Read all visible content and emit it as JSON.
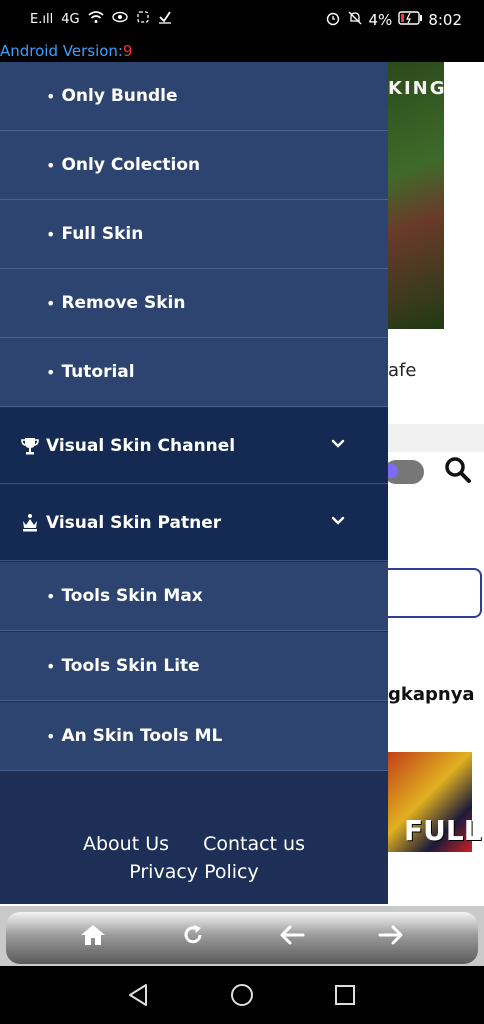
{
  "status_bar": {
    "network_left": "E.ıll",
    "network_4g": "4G",
    "battery_percent": "4%",
    "time": "8:02"
  },
  "version": {
    "label": "Android Version:",
    "value": "9"
  },
  "background_page": {
    "banner_text": "KING",
    "text_1": "afe",
    "text_2": "gkapnya",
    "thumb_text": "FULL"
  },
  "drawer": {
    "submenu_1": [
      {
        "label": "Only Bundle"
      },
      {
        "label": "Only Colection"
      },
      {
        "label": "Full Skin"
      },
      {
        "label": "Remove Skin"
      },
      {
        "label": "Tutorial"
      }
    ],
    "section_channel": {
      "label": "Visual Skin Channel",
      "icon": "trophy-icon"
    },
    "section_partner": {
      "label": "Visual Skin Patner",
      "icon": "crown-icon"
    },
    "submenu_2": [
      {
        "label": "Tools Skin Max"
      },
      {
        "label": "Tools Skin Lite"
      },
      {
        "label": "An Skin Tools ML"
      }
    ],
    "footer": {
      "about": "About Us",
      "contact": "Contact us",
      "privacy": "Privacy Policy"
    }
  },
  "colors": {
    "drawer_bg": "#1d2f56",
    "submenu_bg": "#2d4470",
    "section_bg": "#142a52",
    "version_label": "#3aa0ff",
    "version_value": "#ff3030"
  }
}
